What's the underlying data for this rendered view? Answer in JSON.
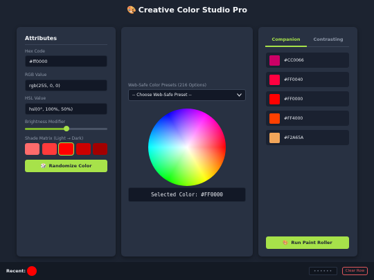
{
  "header": {
    "title": "Creative Color Studio Pro",
    "icon": "palette-icon"
  },
  "attributes": {
    "heading": "Attributes",
    "hex_label": "Hex Code",
    "hex_value": "#ff0000",
    "rgb_label": "RGB Value",
    "rgb_value": "rgb(255, 0, 0)",
    "hsl_label": "HSL Value",
    "hsl_value": "hsl(0°, 100%, 50%)",
    "brightness_label": "Brightness Modifier",
    "brightness_value": 0.5,
    "shade_label": "Shade Matrix (Light → Dark)",
    "shades": [
      "#ff6b6b",
      "#ff3b3b",
      "#ff0000",
      "#cc0000",
      "#a30000"
    ],
    "selected_shade_index": 2,
    "randomize_label": "Randomize Color",
    "randomize_icon": "dice-icon"
  },
  "picker": {
    "preset_label": "Web-Safe Color Presets (216 Options)",
    "preset_selected": "-- Choose Web-Safe Preset --",
    "selected_text": "Selected Color: #FF0000"
  },
  "palette": {
    "tabs": [
      "Companion",
      "Contrasting"
    ],
    "active_tab": "Companion",
    "swatches": [
      {
        "hex": "#CC0066",
        "color": "#CC0066"
      },
      {
        "hex": "#FF0040",
        "color": "#FF0040"
      },
      {
        "hex": "#FF0000",
        "color": "#FF0000"
      },
      {
        "hex": "#FF4000",
        "color": "#FF4000"
      },
      {
        "hex": "#F2A65A",
        "color": "#F2A65A"
      }
    ],
    "roller_label": "Run Paint Roller",
    "roller_icon": "paint-roller-icon"
  },
  "footer": {
    "recent_label": "Recent:",
    "recent_colors": [
      "#FF0000"
    ],
    "dots_text": "••••••",
    "clear_label": "Clear Row"
  },
  "colors": {
    "accent": "#a7e24a",
    "danger": "#e0575c",
    "panel": "#283142",
    "background": "#1c2330"
  }
}
